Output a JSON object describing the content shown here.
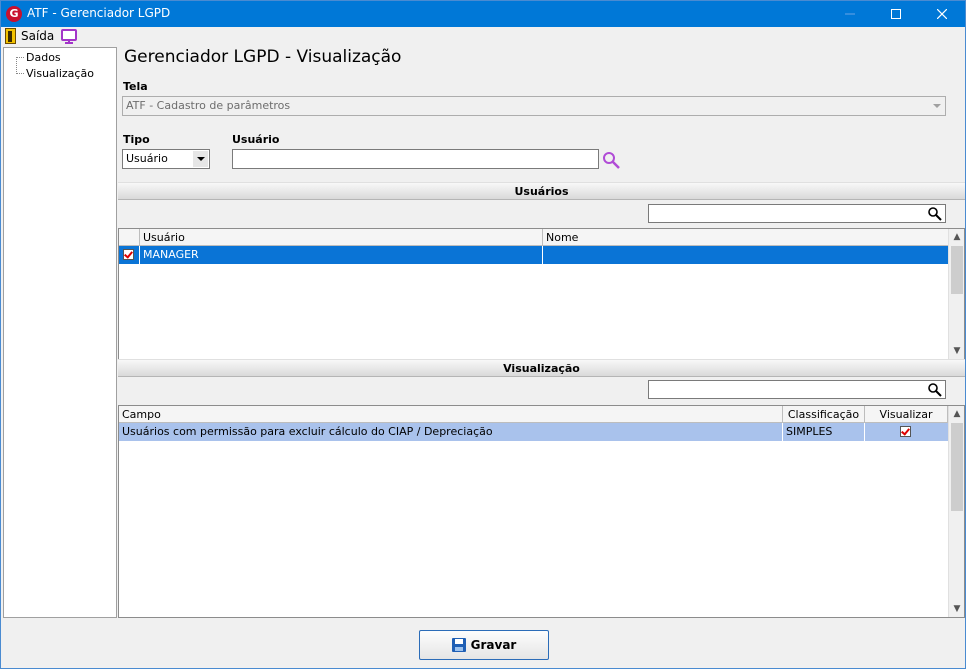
{
  "window": {
    "title": "ATF - Gerenciador LGPD",
    "app_icon": "G"
  },
  "menu": {
    "exit_label": "Saída"
  },
  "tree": {
    "items": [
      "Dados",
      "Visualização"
    ]
  },
  "page": {
    "title": "Gerenciador LGPD - Visualização"
  },
  "form": {
    "tela_label": "Tela",
    "tela_value": "ATF - Cadastro de parâmetros",
    "tipo_label": "Tipo",
    "tipo_value": "Usuário",
    "usuario_label": "Usuário",
    "usuario_value": ""
  },
  "users_section": {
    "title": "Usuários",
    "search_value": "",
    "columns": [
      "Usuário",
      "Nome"
    ],
    "rows": [
      {
        "checked": true,
        "usuario": "MANAGER",
        "nome": ""
      }
    ]
  },
  "view_section": {
    "title": "Visualização",
    "search_value": "",
    "columns": [
      "Campo",
      "Classificação",
      "Visualizar"
    ],
    "rows": [
      {
        "campo": "Usuários com permissão para excluir cálculo do CIAP / Depreciação",
        "classificacao": "SIMPLES",
        "visualizar": true
      }
    ]
  },
  "actions": {
    "save_label": "Gravar"
  },
  "colors": {
    "titlebar": "#0078d7",
    "selected_row": "#0a74d6",
    "highlight_row": "#a9c2ec",
    "accent_purple": "#a335c9"
  }
}
